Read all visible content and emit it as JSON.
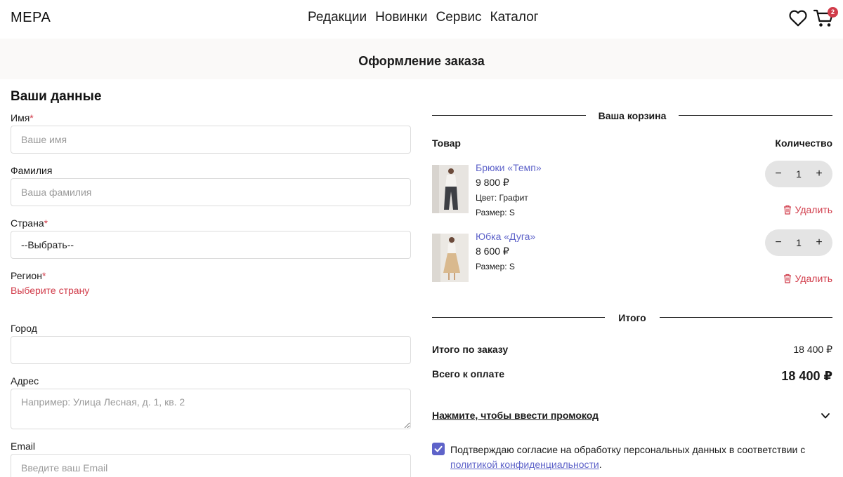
{
  "header": {
    "logo": "МЕРА",
    "nav": [
      "Редакции",
      "Новинки",
      "Сервис",
      "Каталог"
    ],
    "cart_count": "2"
  },
  "page_title": "Оформление заказа",
  "form": {
    "title": "Ваши данные",
    "first_name": {
      "label": "Имя",
      "required_mark": "*",
      "placeholder": "Ваше имя"
    },
    "last_name": {
      "label": "Фамилия",
      "placeholder": "Ваша фамилия"
    },
    "country": {
      "label": "Страна",
      "required_mark": "*",
      "value": "--Выбрать--"
    },
    "region": {
      "label": "Регион",
      "required_mark": "*",
      "error": "Выберите страну"
    },
    "city": {
      "label": "Город",
      "value": ""
    },
    "address": {
      "label": "Адрес",
      "placeholder": "Например: Улица Лесная, д. 1, кв. 2"
    },
    "email": {
      "label": "Email",
      "placeholder": "Введите ваш Email"
    }
  },
  "cart": {
    "title": "Ваша корзина",
    "col_product": "Товар",
    "col_quantity": "Количество",
    "remove_label": "Удалить",
    "items": [
      {
        "name": "Брюки «Темп»",
        "price": "9 800 ₽",
        "color": "Цвет: Графит",
        "size": "Размер: S",
        "quantity": "1"
      },
      {
        "name": "Юбка «Дуга»",
        "price": "8 600 ₽",
        "size": "Размер: S",
        "quantity": "1"
      }
    ]
  },
  "totals": {
    "title": "Итого",
    "order_label": "Итого по заказу",
    "order_value": "18 400 ₽",
    "pay_label": "Всего к оплате",
    "pay_value": "18 400 ₽"
  },
  "promo": {
    "label": "Нажмите, чтобы ввести промокод"
  },
  "consent": {
    "checked": true,
    "text": "Подтверждаю согласие на обработку персональных данных в соответствии с ",
    "link": "политикой конфиденциальности",
    "end": "."
  },
  "colors": {
    "accent": "#5e63c9",
    "error": "#d13c4a",
    "stepper_bg": "#e4e4e4"
  }
}
